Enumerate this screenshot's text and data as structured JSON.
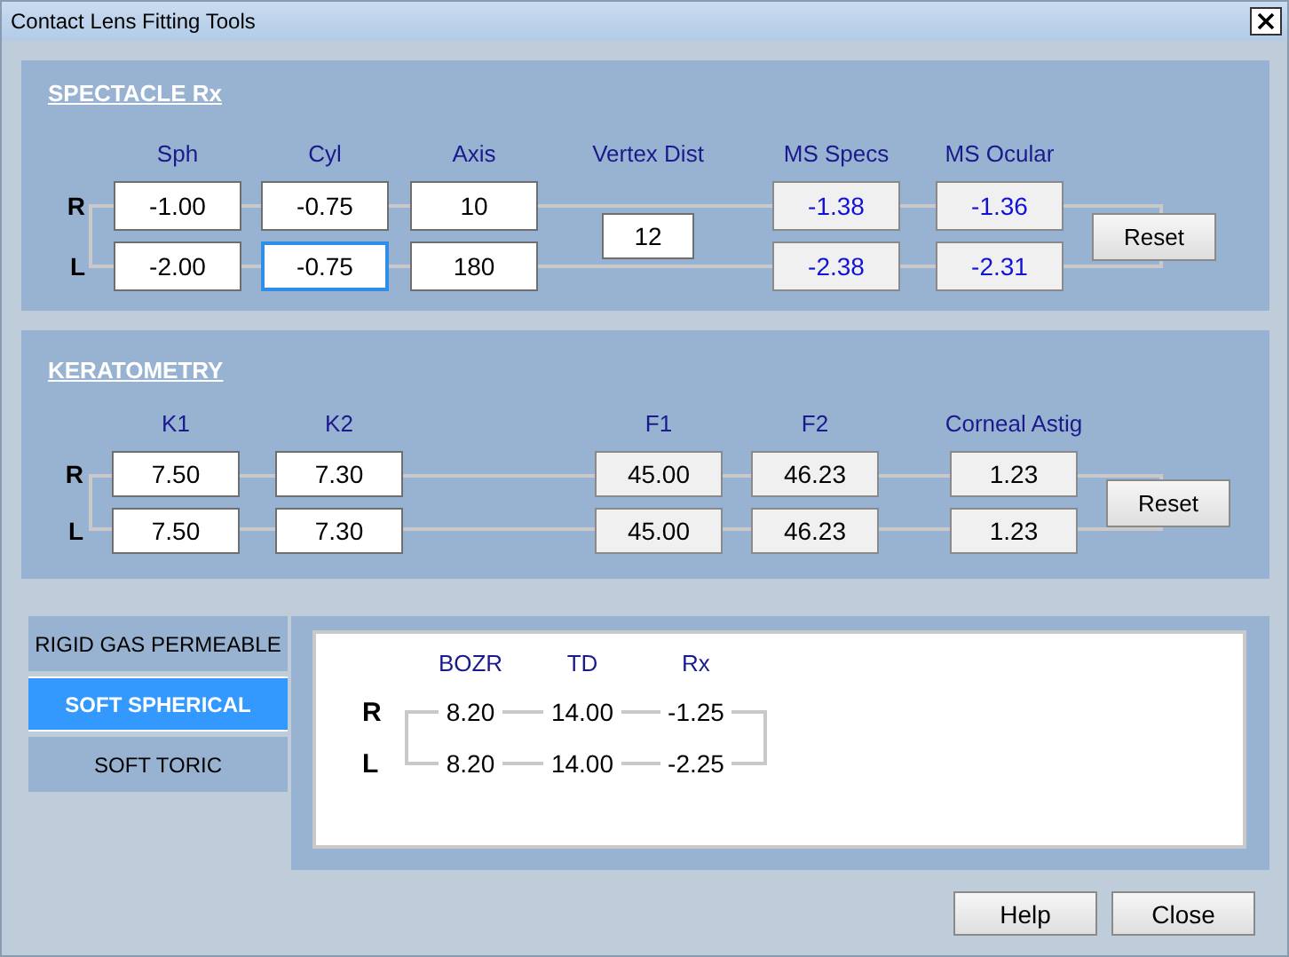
{
  "window": {
    "title": "Contact Lens Fitting Tools"
  },
  "spectacle_rx": {
    "title": "SPECTACLE Rx",
    "columns": [
      "Sph",
      "Cyl",
      "Axis",
      "MS Specs",
      "MS Ocular"
    ],
    "rows": [
      {
        "eye": "R",
        "cells": [
          {
            "value": "-1.00",
            "kind": "input",
            "focused": false
          },
          {
            "value": "-0.75",
            "kind": "input",
            "focused": false
          },
          {
            "value": "10",
            "kind": "input",
            "focused": false
          },
          {
            "value": "-1.38",
            "kind": "computed",
            "focused": false
          },
          {
            "value": "-1.36",
            "kind": "computed",
            "focused": false
          }
        ]
      },
      {
        "eye": "L",
        "cells": [
          {
            "value": "-2.00",
            "kind": "input",
            "focused": false
          },
          {
            "value": "-0.75",
            "kind": "input",
            "focused": true
          },
          {
            "value": "180",
            "kind": "input",
            "focused": false
          },
          {
            "value": "-2.38",
            "kind": "computed",
            "focused": false
          },
          {
            "value": "-2.31",
            "kind": "computed",
            "focused": false
          }
        ]
      }
    ],
    "vertex_dist": {
      "label": "Vertex Dist",
      "value": "12",
      "focused": false
    },
    "reset_button": "Reset"
  },
  "keratometry": {
    "title": "KERATOMETRY",
    "columns": [
      "K1",
      "K2",
      "F1",
      "F2",
      "Corneal Astig"
    ],
    "rows": [
      {
        "eye": "R",
        "cells": [
          {
            "value": "7.50",
            "kind": "input",
            "focused": false
          },
          {
            "value": "7.30",
            "kind": "input",
            "focused": false
          },
          {
            "value": "45.00",
            "kind": "readonly",
            "focused": false
          },
          {
            "value": "46.23",
            "kind": "readonly",
            "focused": false
          },
          {
            "value": "1.23",
            "kind": "readonly",
            "focused": false
          }
        ]
      },
      {
        "eye": "L",
        "cells": [
          {
            "value": "7.50",
            "kind": "input",
            "focused": false
          },
          {
            "value": "7.30",
            "kind": "input",
            "focused": false
          },
          {
            "value": "45.00",
            "kind": "readonly",
            "focused": false
          },
          {
            "value": "46.23",
            "kind": "readonly",
            "focused": false
          },
          {
            "value": "1.23",
            "kind": "readonly",
            "focused": false
          }
        ]
      }
    ],
    "reset_button": "Reset"
  },
  "lens_types": [
    {
      "label": "RIGID GAS PERMEABLE",
      "selected": false
    },
    {
      "label": "SOFT SPHERICAL",
      "selected": true
    },
    {
      "label": "SOFT TORIC",
      "selected": false
    }
  ],
  "lens_result": {
    "columns": [
      "BOZR",
      "TD",
      "Rx"
    ],
    "rows": [
      {
        "eye": "R",
        "values": [
          "8.20",
          "14.00",
          "-1.25"
        ]
      },
      {
        "eye": "L",
        "values": [
          "8.20",
          "14.00",
          "-2.25"
        ]
      }
    ]
  },
  "buttons": [
    "Help",
    "Close"
  ]
}
